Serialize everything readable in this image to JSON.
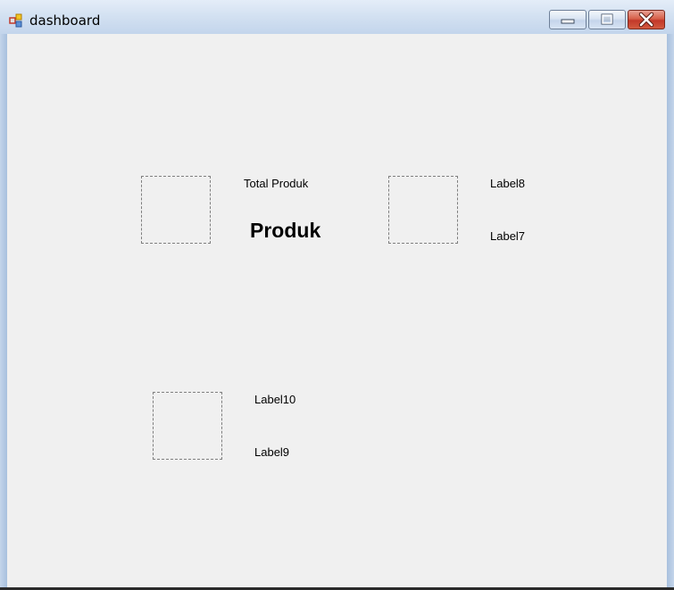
{
  "window": {
    "title": "dashboard",
    "controls": {
      "minimize": "minimize-icon",
      "maximize": "maximize-icon",
      "close": "close-icon"
    }
  },
  "form": {
    "group1": {
      "caption": "Total Produk",
      "value": "Produk"
    },
    "group2": {
      "caption": "Label8",
      "value": "Label7"
    },
    "group3": {
      "caption": "Label10",
      "value": "Label9"
    }
  }
}
